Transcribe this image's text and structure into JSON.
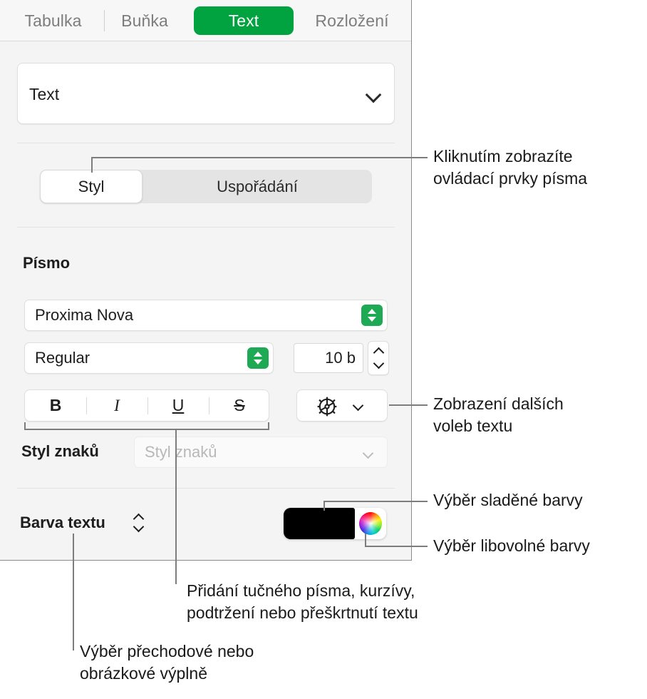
{
  "panel": {
    "tabs": [
      {
        "label": "Tabulka",
        "active": false
      },
      {
        "label": "Buňka",
        "active": false
      },
      {
        "label": "Text",
        "active": true
      },
      {
        "label": "Rozložení",
        "active": false
      }
    ],
    "style_popup": {
      "value": "Text",
      "chevron_icon": "chevron-down-icon"
    },
    "segmented": {
      "options": [
        "Styl",
        "Uspořádání"
      ],
      "selected": "Styl"
    },
    "font_section": {
      "heading": "Písmo",
      "family": "Proxima Nova",
      "style": "Regular",
      "size": "10 b",
      "format_buttons": [
        {
          "id": "bold",
          "label": "B"
        },
        {
          "id": "italic",
          "label": "I"
        },
        {
          "id": "underline",
          "label": "U"
        },
        {
          "id": "strike",
          "label": "S"
        }
      ],
      "gear_button": {
        "icon": "gear-icon",
        "chevron_icon": "chevron-down-icon"
      }
    },
    "character_style": {
      "label": "Styl znaků",
      "placeholder": "Styl znaků",
      "chevron_icon": "chevron-down-icon"
    },
    "text_color": {
      "label": "Barva textu",
      "arrows_icon": "up-down-arrows-icon",
      "swatch_color": "#000000",
      "wheel_icon": "color-wheel-icon"
    }
  },
  "callouts": {
    "font_controls": "Kliknutím zobrazíte\novládací prvky písma",
    "more_text_options": "Zobrazení dalších\nvoleb textu",
    "matched_color": "Výběr sladěné barvy",
    "any_color": "Výběr libovolné barvy",
    "bold_italic": "Přidání tučného písma, kurzívy,\npodtržení nebo přeškrtnutí textu",
    "gradient_fill": "Výběr přechodové nebo\nobrázkové výplně"
  },
  "colors": {
    "accent_green": "#00a33f",
    "stepper_green": "#1eaa55",
    "leader_line": "#7d7d7d",
    "panel_bg": "#f4f4f4"
  }
}
